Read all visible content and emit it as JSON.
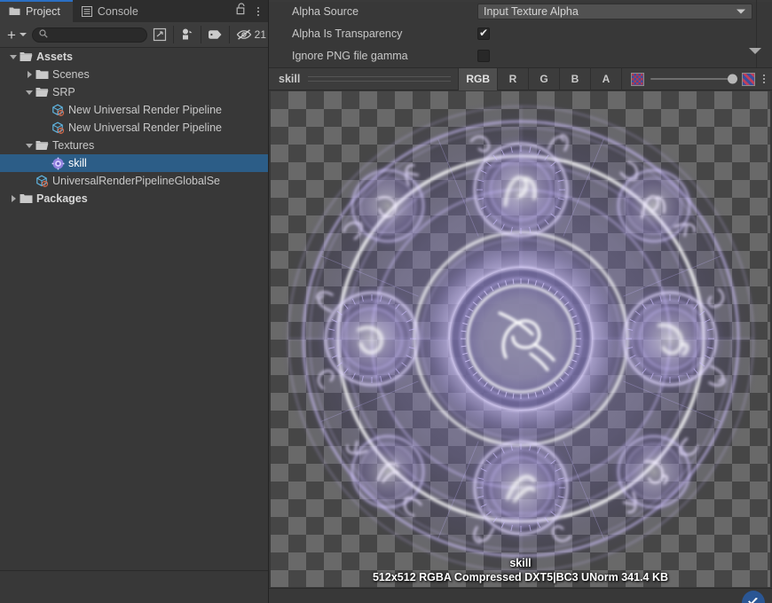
{
  "project_panel": {
    "tabs": [
      {
        "label": "Project",
        "icon": "folder-icon",
        "active": true
      },
      {
        "label": "Console",
        "icon": "console-icon",
        "active": false
      }
    ],
    "lock_icon": "lock-open-icon",
    "menu_icon": "kebab-menu-icon",
    "toolbar": {
      "add_label": "+",
      "add_icon": "plus-icon",
      "add_caret_icon": "chevron-down-icon",
      "search_value": "",
      "search_placeholder": "",
      "search_icon": "search-icon",
      "scene_search_icon": "search-in-scene-icon",
      "type_filter_icon": "filter-by-type-icon",
      "label_filter_icon": "filter-by-label-icon",
      "hidden_items_icon": "eye-off-icon",
      "hidden_items_count": "21"
    },
    "tree": [
      {
        "label": "Assets",
        "indent": 0,
        "twisty": "open",
        "icon": "folder-open-icon",
        "bold": true,
        "selected": false
      },
      {
        "label": "Scenes",
        "indent": 1,
        "twisty": "closed",
        "icon": "folder-icon",
        "bold": false,
        "selected": false
      },
      {
        "label": "SRP",
        "indent": 1,
        "twisty": "open",
        "icon": "folder-open-icon",
        "bold": false,
        "selected": false
      },
      {
        "label": "New Universal Render Pipeline",
        "indent": 2,
        "twisty": "none",
        "icon": "asset-cube-icon",
        "bold": false,
        "selected": false
      },
      {
        "label": "New Universal Render Pipeline",
        "indent": 2,
        "twisty": "none",
        "icon": "asset-cube-icon",
        "bold": false,
        "selected": false
      },
      {
        "label": "Textures",
        "indent": 1,
        "twisty": "open",
        "icon": "folder-open-icon",
        "bold": false,
        "selected": false
      },
      {
        "label": "skill",
        "indent": 2,
        "twisty": "none",
        "icon": "texture-icon",
        "bold": false,
        "selected": true
      },
      {
        "label": "UniversalRenderPipelineGlobalSe",
        "indent": 1,
        "twisty": "none",
        "icon": "asset-cube-icon",
        "bold": false,
        "selected": false
      },
      {
        "label": "Packages",
        "indent": 0,
        "twisty": "closed",
        "icon": "folder-icon",
        "bold": true,
        "selected": false
      }
    ]
  },
  "inspector": {
    "fields": [
      {
        "label": "Alpha Source",
        "type": "dropdown",
        "value": "Input Texture Alpha",
        "caret_icon": "chevron-down-icon"
      },
      {
        "label": "Alpha Is Transparency",
        "type": "checkbox",
        "checked": true,
        "check_glyph": "✔"
      },
      {
        "label": "Ignore PNG file gamma",
        "type": "checkbox",
        "checked": false,
        "check_glyph": ""
      }
    ],
    "scroll_down_icon": "scroll-down-triangle-icon"
  },
  "preview": {
    "title": "skill",
    "channel_buttons": [
      {
        "label": "RGB",
        "active": true
      },
      {
        "label": "R",
        "active": false
      },
      {
        "label": "G",
        "active": false
      },
      {
        "label": "B",
        "active": false
      },
      {
        "label": "A",
        "active": false
      }
    ],
    "mip_low_icon": "mip-low-icon",
    "mip_high_icon": "mip-high-icon",
    "mip_slider_value": "100",
    "options_icon": "kebab-menu-icon",
    "status_name": "skill",
    "status_info": "512x512  RGBA Compressed DXT5|BC3 UNorm   341.4 KB",
    "collab_icon": "collab-cloud-icon"
  },
  "colors": {
    "panel_bg": "#383838",
    "toolbar_bg": "#3c3c3c",
    "tab_inactive_bg": "#2d2d2d",
    "accent_tab": "#2b6fc4",
    "selection": "#2c5d87",
    "text": "#c8c8c8",
    "checker_dark": "#464646",
    "checker_light": "#696969",
    "magic_glow": "#b9a6ff",
    "magic_core": "#ffffff"
  }
}
